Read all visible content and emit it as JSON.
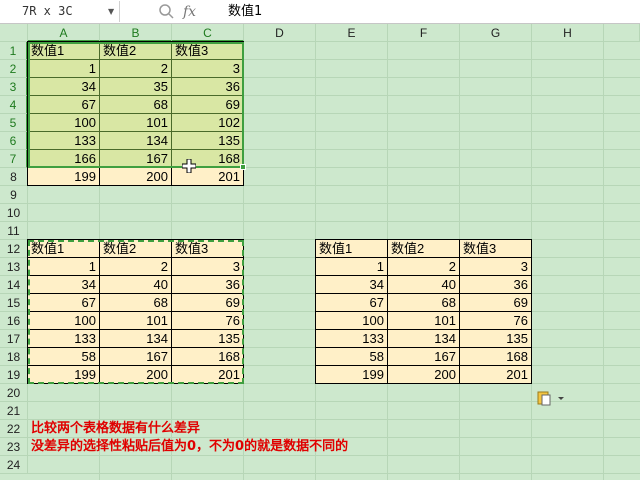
{
  "formula_bar": {
    "name_box": "7R x 3C",
    "formula": "数值1"
  },
  "columns": [
    "A",
    "B",
    "C",
    "D",
    "E",
    "F",
    "G",
    "H"
  ],
  "rows": [
    "1",
    "2",
    "3",
    "4",
    "5",
    "6",
    "7",
    "8",
    "9",
    "10",
    "11",
    "12",
    "13",
    "14",
    "15",
    "16",
    "17",
    "18",
    "19",
    "20",
    "21",
    "22",
    "23",
    "24"
  ],
  "table1": {
    "headers": [
      "数值1",
      "数值2",
      "数值3"
    ],
    "rows": [
      [
        "1",
        "2",
        "3"
      ],
      [
        "34",
        "35",
        "36"
      ],
      [
        "67",
        "68",
        "69"
      ],
      [
        "100",
        "101",
        "102"
      ],
      [
        "133",
        "134",
        "135"
      ],
      [
        "166",
        "167",
        "168"
      ],
      [
        "199",
        "200",
        "201"
      ]
    ]
  },
  "table2": {
    "headers": [
      "数值1",
      "数值2",
      "数值3"
    ],
    "rows": [
      [
        "1",
        "2",
        "3"
      ],
      [
        "34",
        "40",
        "36"
      ],
      [
        "67",
        "68",
        "69"
      ],
      [
        "100",
        "101",
        "76"
      ],
      [
        "133",
        "134",
        "135"
      ],
      [
        "58",
        "167",
        "168"
      ],
      [
        "199",
        "200",
        "201"
      ]
    ]
  },
  "table3": {
    "headers": [
      "数值1",
      "数值2",
      "数值3"
    ],
    "rows": [
      [
        "1",
        "2",
        "3"
      ],
      [
        "34",
        "40",
        "36"
      ],
      [
        "67",
        "68",
        "69"
      ],
      [
        "100",
        "101",
        "76"
      ],
      [
        "133",
        "134",
        "135"
      ],
      [
        "58",
        "167",
        "168"
      ],
      [
        "199",
        "200",
        "201"
      ]
    ]
  },
  "notes": {
    "line1": "比较两个表格数据有什么差异",
    "line2": "没差异的选择性粘贴后值为0，不为0的就是数据不同的"
  },
  "colors": {
    "grid_background": "#cde8cd",
    "cell_fill": "#fff0c8",
    "selected_fill": "#d9e7a4",
    "selection_border": "#3f9f3f",
    "note_text": "#e00000"
  }
}
